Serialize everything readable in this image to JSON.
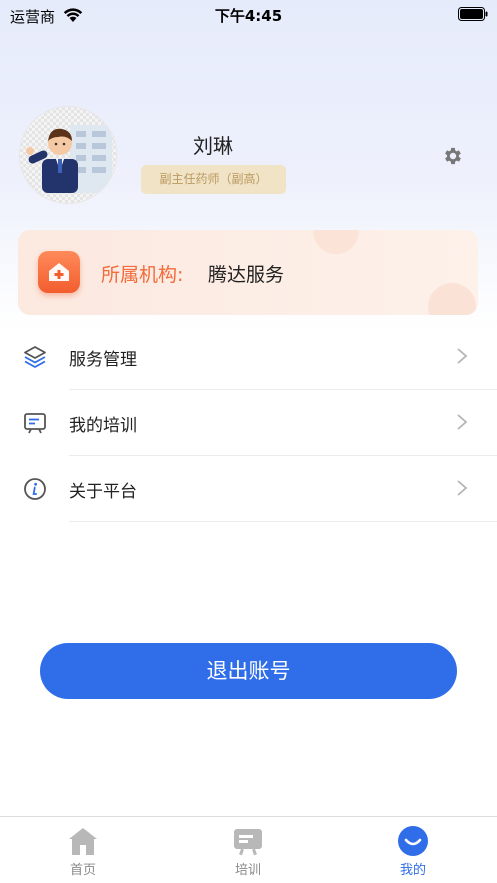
{
  "status_bar": {
    "carrier": "运营商",
    "time": "下午4:45"
  },
  "profile": {
    "name": "刘琳",
    "title": "副主任药师（副高）"
  },
  "org": {
    "label": "所属机构:",
    "name": "腾达服务"
  },
  "menu": [
    {
      "label": "服务管理",
      "icon": "layers-icon"
    },
    {
      "label": "我的培训",
      "icon": "training-board-icon"
    },
    {
      "label": "关于平台",
      "icon": "info-icon"
    }
  ],
  "logout_label": "退出账号",
  "tabs": [
    {
      "label": "首页",
      "icon": "home-icon",
      "active": false
    },
    {
      "label": "培训",
      "icon": "training-icon",
      "active": false
    },
    {
      "label": "我的",
      "icon": "mine-icon",
      "active": true
    }
  ],
  "colors": {
    "primary": "#2f6ee8",
    "org_accent": "#f26b3a",
    "title_badge_bg": "#f0e3c6",
    "title_badge_text": "#bb9a60"
  }
}
